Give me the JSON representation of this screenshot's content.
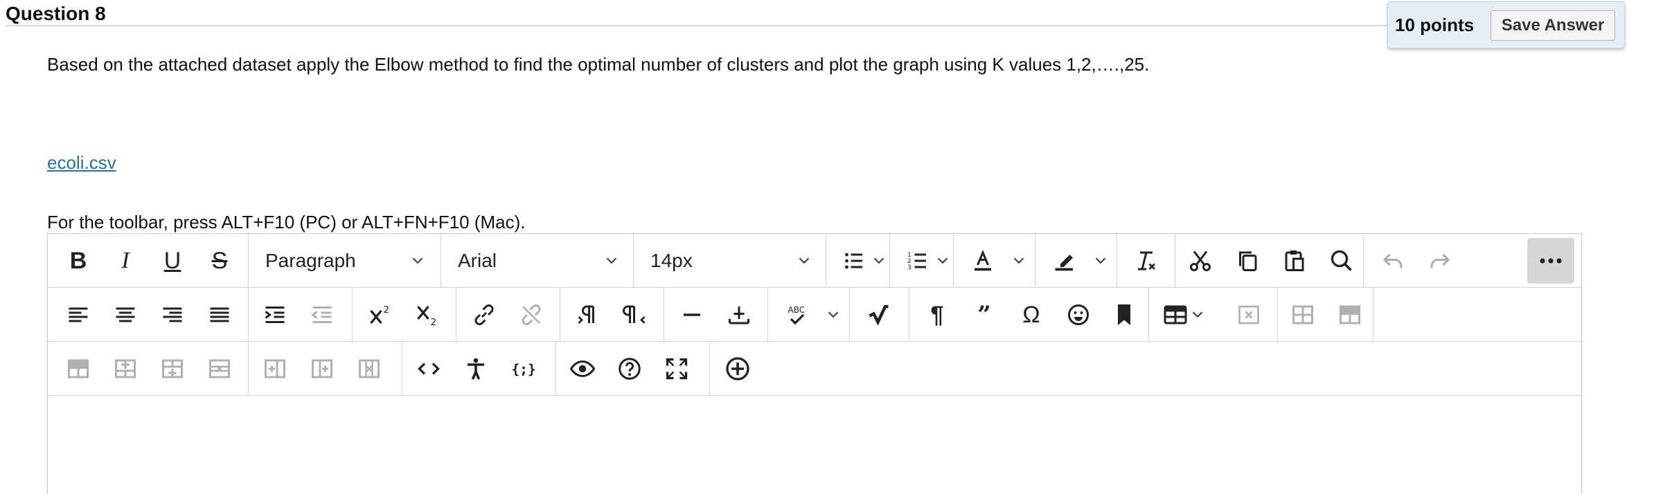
{
  "question": {
    "title": "Question 8",
    "points": "10 points",
    "save_label": "Save Answer"
  },
  "prompt": "Based on the attached dataset apply the Elbow method to find the optimal number of clusters and plot the graph using K values 1,2,….,25.",
  "attachment": {
    "filename": "ecoli.csv"
  },
  "toolbar_hint": "For the toolbar, press ALT+F10 (PC) or ALT+FN+F10 (Mac).",
  "toolbar": {
    "block_format": "Paragraph",
    "font_family": "Arial",
    "font_size": "14px",
    "omega_glyph": "Ω"
  },
  "colors": {
    "link": "#2b6f9c",
    "points_bg": "#e3eef6",
    "active_button_bg": "#d6d6d6"
  }
}
